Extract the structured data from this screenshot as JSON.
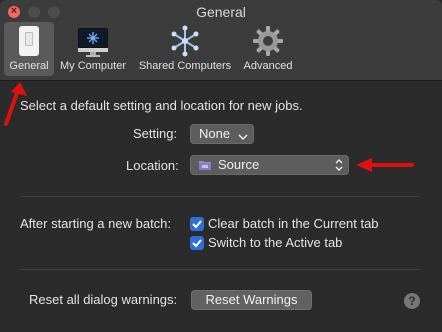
{
  "window": {
    "title": "General",
    "close_glyph": "×"
  },
  "toolbar": {
    "items": [
      {
        "label": "General",
        "icon": "device-icon",
        "active": true
      },
      {
        "label": "My Computer",
        "icon": "monitor-icon"
      },
      {
        "label": "Shared Computers",
        "icon": "cluster-icon"
      },
      {
        "label": "Advanced",
        "icon": "gear-icon"
      }
    ]
  },
  "defaults": {
    "intro": "Select a default setting and location for new jobs.",
    "setting_label": "Setting:",
    "setting_value": "None",
    "location_label": "Location:",
    "location_value": "Source"
  },
  "batch": {
    "label": "After starting a new batch:",
    "options": [
      {
        "label": "Clear batch in the Current tab",
        "checked": true
      },
      {
        "label": "Switch to the Active tab",
        "checked": true
      }
    ]
  },
  "warnings": {
    "label": "Reset all dialog warnings:",
    "button": "Reset Warnings"
  },
  "help": {
    "glyph": "?"
  },
  "colors": {
    "accent": "#2f6fd5",
    "annotation": "#e01010"
  }
}
